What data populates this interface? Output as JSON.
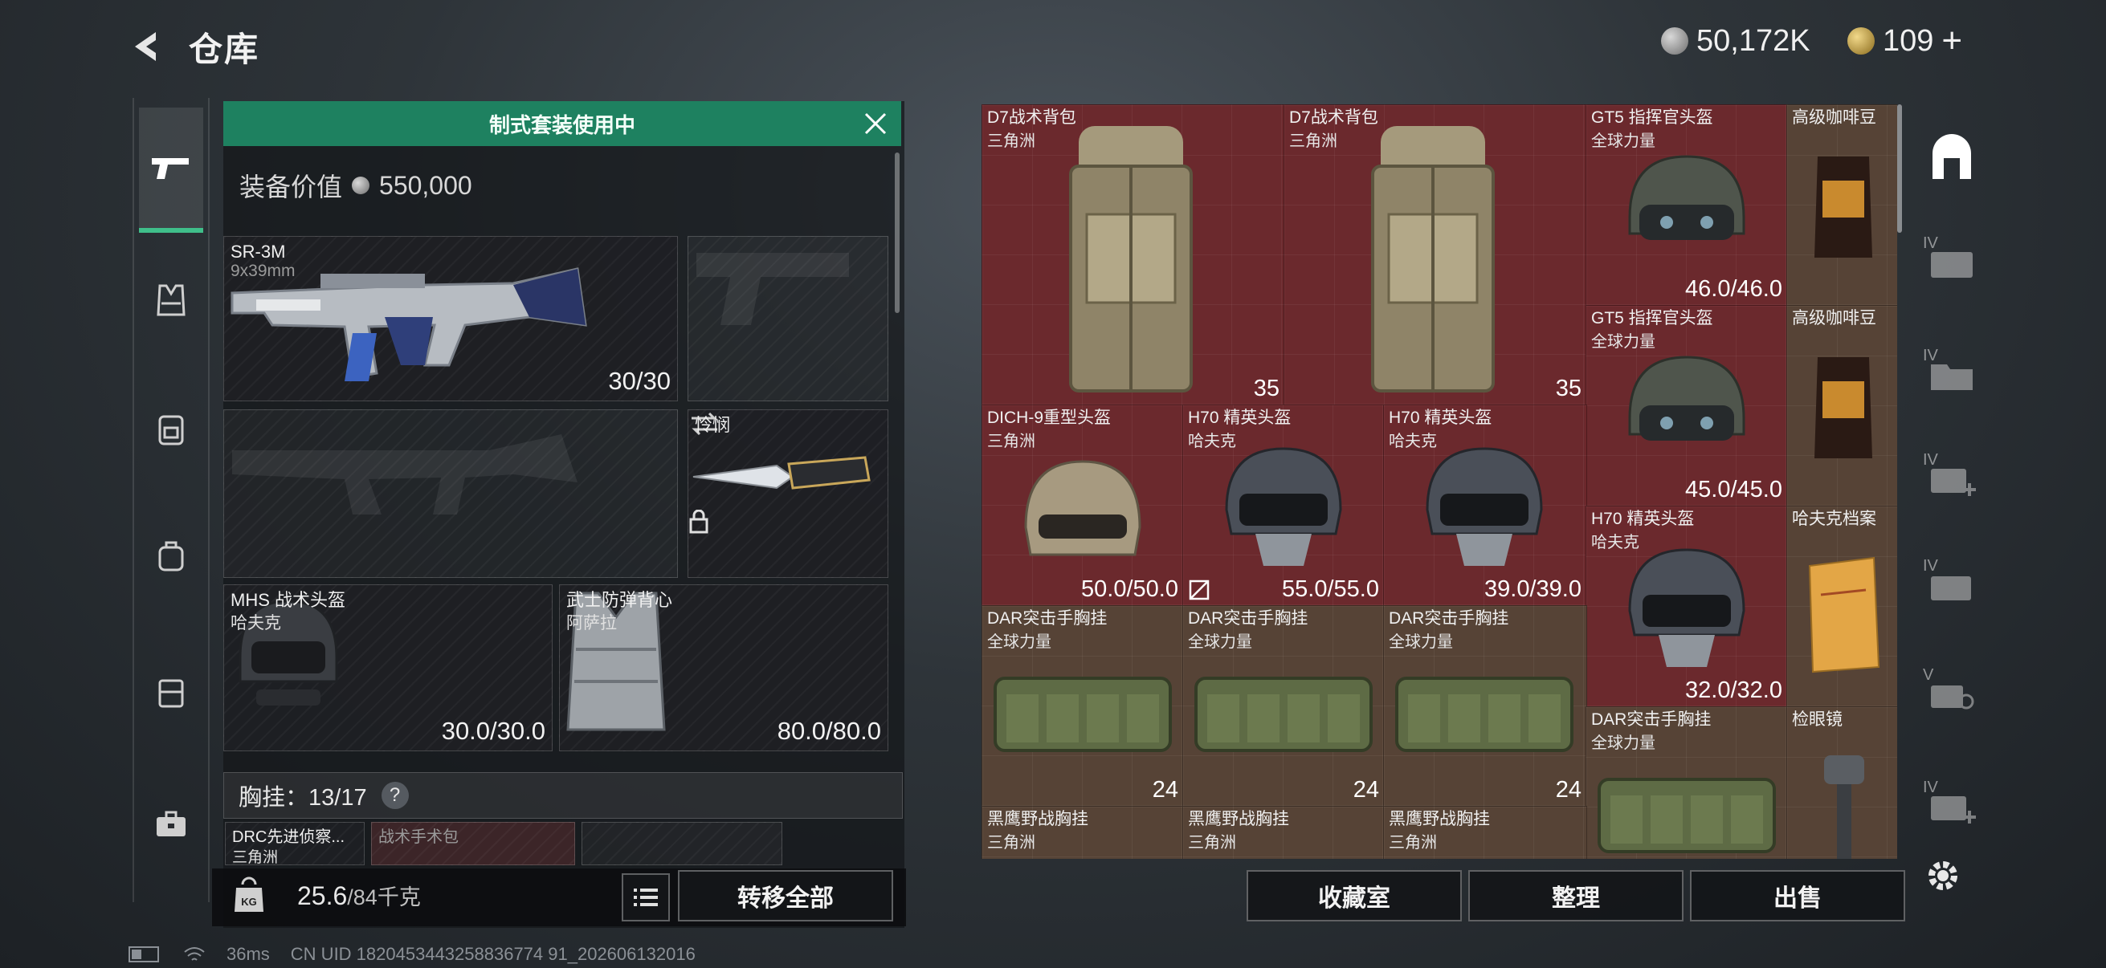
{
  "header": {
    "title": "仓库",
    "currency1": "50,172K",
    "currency2": "109",
    "currency2_plus": "+"
  },
  "banner": {
    "text": "制式套装使用中"
  },
  "equipment_value": {
    "label": "装备价值",
    "value": "550,000"
  },
  "loadout": {
    "primary": {
      "name": "SR-3M",
      "caliber": "9x39mm",
      "ammo": "30/30"
    },
    "knife": {
      "name": "怜悯"
    },
    "helmet": {
      "name": "MHS 战术头盔",
      "faction": "哈夫克",
      "durability": "30.0/30.0"
    },
    "armor": {
      "name": "武士防弹背心",
      "faction": "阿萨拉",
      "durability": "80.0/80.0"
    },
    "chest_rig": {
      "label": "胸挂：",
      "count": "13/17",
      "help": "?"
    },
    "partial_items": [
      "DRC先进侦察...",
      "战术手术包"
    ],
    "partial_sub": "三角洲"
  },
  "weight": {
    "value": "25.6",
    "max": "/84千克",
    "icon_label": "KG"
  },
  "buttons": {
    "transfer_all": "转移全部",
    "collection": "收藏室",
    "organize": "整理",
    "sell": "出售"
  },
  "stash": {
    "items": [
      {
        "name": "D7战术背包",
        "sub": "三角洲",
        "value": "35"
      },
      {
        "name": "D7战术背包",
        "sub": "三角洲",
        "value": "35"
      },
      {
        "name": "GT5 指挥官头盔",
        "sub": "全球力量",
        "value": "46.0/46.0"
      },
      {
        "name": "高级咖啡豆",
        "sub": "",
        "value": ""
      },
      {
        "name": "GT5 指挥官头盔",
        "sub": "全球力量",
        "value": "45.0/45.0"
      },
      {
        "name": "高级咖啡豆",
        "sub": "",
        "value": ""
      },
      {
        "name": "DICH-9重型头盔",
        "sub": "三角洲",
        "value": "50.0/50.0"
      },
      {
        "name": "H70 精英头盔",
        "sub": "哈夫克",
        "value": "55.0/55.0"
      },
      {
        "name": "H70 精英头盔",
        "sub": "哈夫克",
        "value": "39.0/39.0"
      },
      {
        "name": "H70 精英头盔",
        "sub": "哈夫克",
        "value": "32.0/32.0"
      },
      {
        "name": "哈夫克档案",
        "sub": "",
        "value": ""
      },
      {
        "name": "DAR突击手胸挂",
        "sub": "全球力量",
        "value": "24"
      },
      {
        "name": "DAR突击手胸挂",
        "sub": "全球力量",
        "value": "24"
      },
      {
        "name": "DAR突击手胸挂",
        "sub": "全球力量",
        "value": "24"
      },
      {
        "name": "DAR突击手胸挂",
        "sub": "全球力量",
        "value": ""
      },
      {
        "name": "检眼镜",
        "sub": "",
        "value": ""
      },
      {
        "name": "黑鹰野战胸挂",
        "sub": "三角洲",
        "value": ""
      },
      {
        "name": "黑鹰野战胸挂",
        "sub": "三角洲",
        "value": ""
      },
      {
        "name": "黑鹰野战胸挂",
        "sub": "三角洲",
        "value": ""
      }
    ]
  },
  "sidebar_right": {
    "labels": [
      "IV",
      "IV",
      "IV",
      "IV",
      "V",
      "IV"
    ]
  },
  "status": {
    "ping": "36ms",
    "uid": "CN UID 1820453443258836774 91_202606132016"
  },
  "colors": {
    "accent_green": "#1e8160",
    "stash_red": "#76282d",
    "stash_brown": "#5c4638"
  }
}
